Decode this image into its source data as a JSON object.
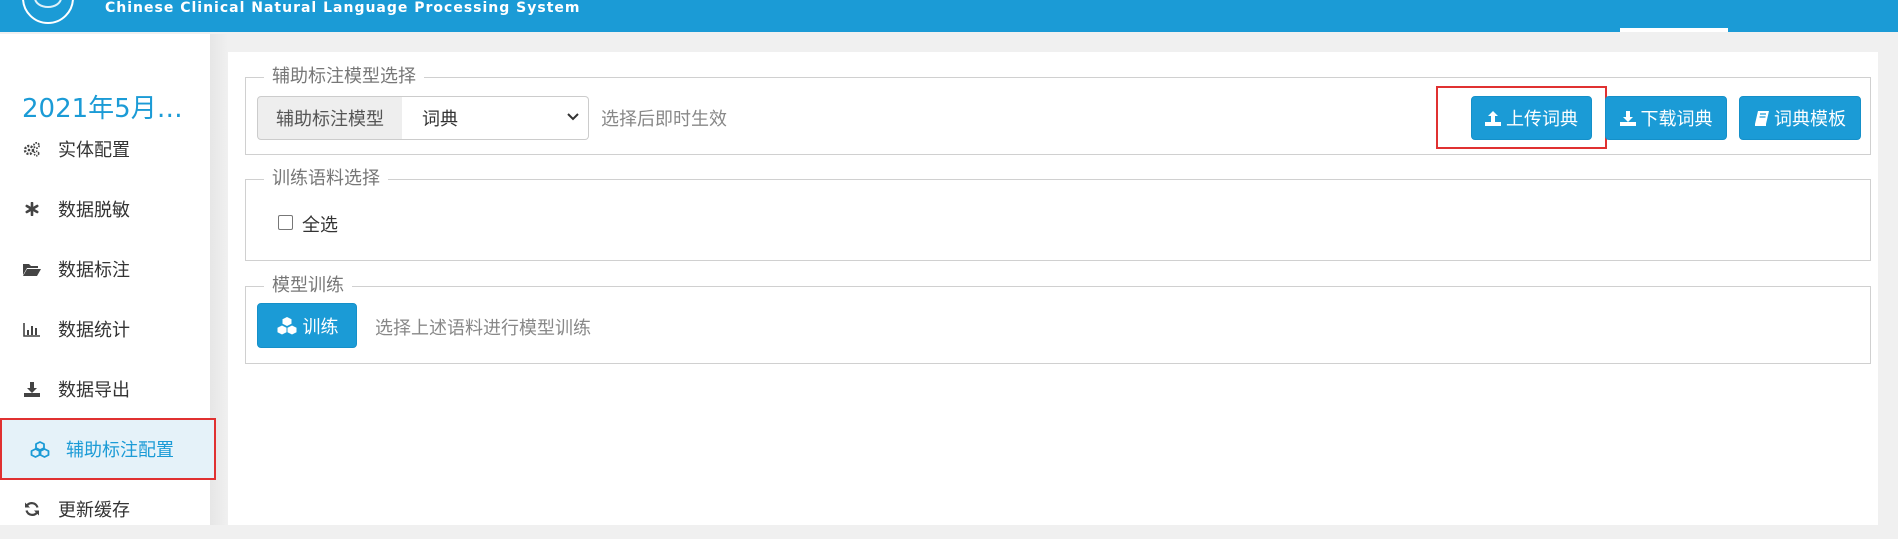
{
  "header": {
    "system_title": "Chinese Clinical Natural Language Processing System",
    "brand_color": "#1b9bd6"
  },
  "sidebar": {
    "project_title": "2021年5月…",
    "items": [
      {
        "label": "实体配置",
        "icon": "gears-icon",
        "active": false
      },
      {
        "label": "数据脱敏",
        "icon": "asterisk-icon",
        "active": false
      },
      {
        "label": "数据标注",
        "icon": "folder-open-icon",
        "active": false
      },
      {
        "label": "数据统计",
        "icon": "bar-chart-icon",
        "active": false
      },
      {
        "label": "数据导出",
        "icon": "download-icon",
        "active": false
      },
      {
        "label": "辅助标注配置",
        "icon": "cubes-icon",
        "active": true
      },
      {
        "label": "更新缓存",
        "icon": "refresh-icon",
        "active": false
      }
    ]
  },
  "model_select": {
    "legend": "辅助标注模型选择",
    "addon_label": "辅助标注模型",
    "selected": "词典",
    "hint": "选择后即时生效",
    "upload_label": "上传词典",
    "download_label": "下载词典",
    "template_label": "词典模板"
  },
  "corpus_select": {
    "legend": "训练语料选择",
    "select_all_label": "全选",
    "select_all_checked": false
  },
  "training": {
    "legend": "模型训练",
    "train_label": "训练",
    "hint": "选择上述语料进行模型训练"
  }
}
